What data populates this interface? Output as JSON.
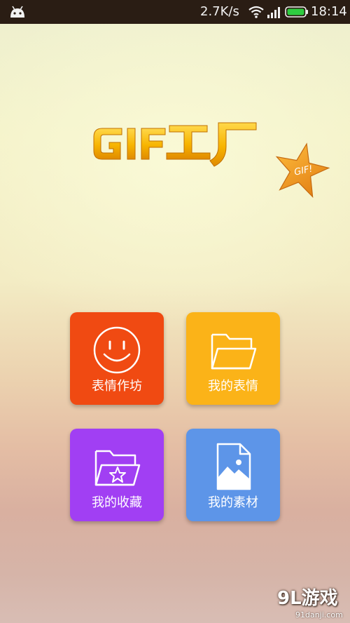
{
  "status_bar": {
    "net_speed": "2.7K/s",
    "time": "18:14",
    "icons": [
      "android-icon",
      "wifi-icon",
      "signal-icon",
      "battery-icon"
    ],
    "battery_color": "#2ecc40"
  },
  "header": {
    "logo_text": "GIF工厂",
    "badge_text": "GIF!",
    "logo_color": "#f7b400",
    "badge_color": "#f09a1a"
  },
  "tiles": [
    {
      "label": "表情作坊",
      "icon": "smiley-icon",
      "color": "#f04a12"
    },
    {
      "label": "我的表情",
      "icon": "folder-icon",
      "color": "#fbb318"
    },
    {
      "label": "我的收藏",
      "icon": "star-folder-icon",
      "color": "#a13ff3"
    },
    {
      "label": "我的素材",
      "icon": "image-file-icon",
      "color": "#5d95e8"
    }
  ],
  "watermark": {
    "brand": "9L游戏",
    "url": "91danji.com"
  }
}
